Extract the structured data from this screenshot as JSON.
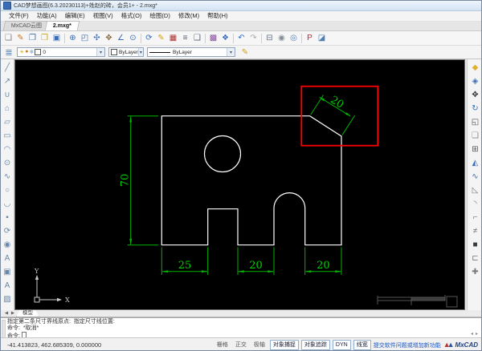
{
  "window": {
    "title": "CAD梦想画图(6.3.20230113)+姓赵的砖，会员1+ - 2.mxg*"
  },
  "menu": {
    "items": [
      {
        "name": "menu-file",
        "label": "文件(F)"
      },
      {
        "name": "menu-function",
        "label": "功能(A)"
      },
      {
        "name": "menu-edit",
        "label": "编辑(E)"
      },
      {
        "name": "menu-view",
        "label": "视图(V)"
      },
      {
        "name": "menu-format",
        "label": "格式(O)"
      },
      {
        "name": "menu-draw",
        "label": "绘图(D)"
      },
      {
        "name": "menu-modify",
        "label": "修改(M)"
      },
      {
        "name": "menu-help",
        "label": "帮助(H)"
      }
    ]
  },
  "tabs": {
    "items": [
      {
        "name": "tab-mxcad-cloud",
        "label": "MxCAD云图",
        "active": false
      },
      {
        "name": "tab-drawing-2mxg",
        "label": "2.mxg*",
        "active": true
      }
    ]
  },
  "toolbar": {
    "icons": [
      {
        "name": "new-file-icon",
        "glyph": "❏",
        "color": "#777777"
      },
      {
        "name": "open-edit-icon",
        "glyph": "✎",
        "color": "#c87820"
      },
      {
        "name": "save-edit-icon",
        "glyph": "❐",
        "color": "#3a6db5"
      },
      {
        "name": "open-folder-icon",
        "glyph": "❒",
        "color": "#c8a020"
      },
      {
        "name": "save-as-icon",
        "glyph": "▣",
        "color": "#3a6db5"
      },
      {
        "sep": true
      },
      {
        "name": "zoom-in-icon",
        "glyph": "⊕",
        "color": "#3a6db5"
      },
      {
        "name": "zoom-window-icon",
        "glyph": "◰",
        "color": "#3a6db5"
      },
      {
        "name": "zoom-extents-icon",
        "glyph": "✣",
        "color": "#3a6db5"
      },
      {
        "name": "pan-icon",
        "glyph": "✥",
        "color": "#8a6d3b"
      },
      {
        "name": "measure-angle-icon",
        "glyph": "∠",
        "color": "#3a6db5"
      },
      {
        "name": "zoom-scale-icon",
        "glyph": "⊙",
        "color": "#3a6db5"
      },
      {
        "sep": true
      },
      {
        "name": "view-rotate-icon",
        "glyph": "⟳",
        "color": "#3a6db5"
      },
      {
        "name": "draw-order-icon",
        "glyph": "✎",
        "color": "#d4a017"
      },
      {
        "name": "layer-manager-icon",
        "glyph": "▦",
        "color": "#b03030"
      },
      {
        "name": "text-list-icon",
        "glyph": "≡",
        "color": "#556070"
      },
      {
        "name": "window-panel-icon",
        "glyph": "❑",
        "color": "#556070"
      },
      {
        "sep": true
      },
      {
        "name": "palette-icon",
        "glyph": "▩",
        "color": "#8a4fa0"
      },
      {
        "name": "options-icon",
        "glyph": "❖",
        "color": "#3a6db5"
      },
      {
        "sep": true
      },
      {
        "name": "undo-icon",
        "glyph": "↶",
        "color": "#2f6fd0"
      },
      {
        "name": "redo-icon",
        "glyph": "↷",
        "color": "#aaaaaa"
      },
      {
        "sep": true
      },
      {
        "name": "print-icon",
        "glyph": "⊟",
        "color": "#667080"
      },
      {
        "name": "web-publish-icon",
        "glyph": "◉",
        "color": "#848c98"
      },
      {
        "name": "web-open-icon",
        "glyph": "◎",
        "color": "#5580b0"
      },
      {
        "sep": true
      },
      {
        "name": "pdf-export-icon",
        "glyph": "P",
        "color": "#d02030"
      },
      {
        "name": "image-export-icon",
        "glyph": "◪",
        "color": "#4a7fb5"
      }
    ]
  },
  "props_bar": {
    "layer_icons": [
      {
        "name": "layer-on-icon",
        "glyph": "☀",
        "color": "#e0b000"
      },
      {
        "name": "layer-lock-icon",
        "glyph": "●",
        "color": "#c08030"
      },
      {
        "name": "layer-freeze-icon",
        "glyph": "❄",
        "color": "#70a0d0"
      }
    ],
    "layer_value": "0",
    "color_value": "ByLayer",
    "linetype_value": "ByLayer"
  },
  "draw_toolbar": {
    "icons": [
      {
        "name": "line-icon",
        "glyph": "╱"
      },
      {
        "name": "polyline-icon",
        "glyph": "↗"
      },
      {
        "name": "arc-3pt-icon",
        "glyph": "∪"
      },
      {
        "name": "polygon-icon",
        "glyph": "⌂"
      },
      {
        "name": "polygon-any-icon",
        "glyph": "▱"
      },
      {
        "name": "rectangle-icon",
        "glyph": "▭"
      },
      {
        "name": "arc-icon",
        "glyph": "◠"
      },
      {
        "name": "circle-icon",
        "glyph": "⊙"
      },
      {
        "name": "spline-icon",
        "glyph": "∿"
      },
      {
        "name": "ellipse-icon",
        "glyph": "○"
      },
      {
        "name": "revcloud-icon",
        "glyph": "◡"
      },
      {
        "name": "point-icon",
        "glyph": "▪"
      },
      {
        "name": "block-create-icon",
        "glyph": "⟳"
      },
      {
        "name": "block-insert-icon",
        "glyph": "◉"
      },
      {
        "name": "text-icon",
        "glyph": "A"
      },
      {
        "name": "image-attach-icon",
        "glyph": "▣"
      },
      {
        "name": "mtext-icon",
        "glyph": "A"
      },
      {
        "name": "hatch-icon",
        "glyph": "▨"
      }
    ]
  },
  "modify_toolbar": {
    "icons": [
      {
        "name": "erase-icon",
        "glyph": "◆",
        "color": "#e0b030"
      },
      {
        "name": "copy-icon",
        "glyph": "◈",
        "color": "#3a6db5"
      },
      {
        "name": "move-icon",
        "glyph": "✥",
        "color": "#333333"
      },
      {
        "name": "rotate-icon",
        "glyph": "↻",
        "color": "#3a6db5"
      },
      {
        "name": "scale-icon",
        "glyph": "◱",
        "color": "#555555"
      },
      {
        "name": "offset-icon",
        "glyph": "❏",
        "color": "#888888"
      },
      {
        "name": "array-icon",
        "glyph": "⊞",
        "color": "#555555"
      },
      {
        "name": "mirror-icon",
        "glyph": "◭",
        "color": "#3a6db5"
      },
      {
        "name": "spline-edit-icon",
        "glyph": "∿",
        "color": "#3a6db5"
      },
      {
        "name": "trim-icon",
        "glyph": "◺",
        "color": "#777777"
      },
      {
        "name": "fillet-icon",
        "glyph": "◝",
        "color": "#777777"
      },
      {
        "name": "chamfer-icon",
        "glyph": "⌐",
        "color": "#777777"
      },
      {
        "name": "break-icon",
        "glyph": "≠",
        "color": "#777777"
      },
      {
        "name": "solid-3d-icon",
        "glyph": "■",
        "color": "#333a44"
      },
      {
        "name": "stretch-icon",
        "glyph": "⊏",
        "color": "#777777"
      },
      {
        "name": "join-icon",
        "glyph": "✚",
        "color": "#777777"
      }
    ]
  },
  "drawing": {
    "dim_height": "70",
    "dim_bottom_left": "25",
    "dim_bottom_mid": "20",
    "dim_bottom_right": "20",
    "dim_chamfer": "20",
    "ucs_x": "X",
    "ucs_y": "Y",
    "outline_color": "#ffffff",
    "dimension_color": "#00c000",
    "highlight_color": "#ff0000"
  },
  "model_strip": {
    "prev": "◀",
    "next": "▶",
    "tab": "模型"
  },
  "command": {
    "lines": [
      {
        "text": "指定第二条尺寸界线原点:  指定尺寸线位置:"
      },
      {
        "text": "命令:  *取消*"
      },
      {
        "text": "命令:",
        "cursor": true
      }
    ],
    "scroll_left": "◂",
    "scroll_right": "▸"
  },
  "status": {
    "coords": "-41.413823,  462.685309,  0.000000",
    "toggles": [
      {
        "name": "toggle-grid",
        "label": "栅格",
        "pressed": false
      },
      {
        "name": "toggle-ortho",
        "label": "正交",
        "pressed": false
      },
      {
        "name": "toggle-polar",
        "label": "极轴",
        "pressed": false
      },
      {
        "name": "toggle-osnap",
        "label": "对象捕捉",
        "pressed": true
      },
      {
        "name": "toggle-otrack",
        "label": "对象追踪",
        "pressed": true
      },
      {
        "name": "toggle-dyn",
        "label": "DYN",
        "pressed": true
      },
      {
        "name": "toggle-lineweight",
        "label": "线宽",
        "pressed": true
      }
    ],
    "link": "提交软件问题或增加新功能",
    "brand": "MxCAD"
  }
}
